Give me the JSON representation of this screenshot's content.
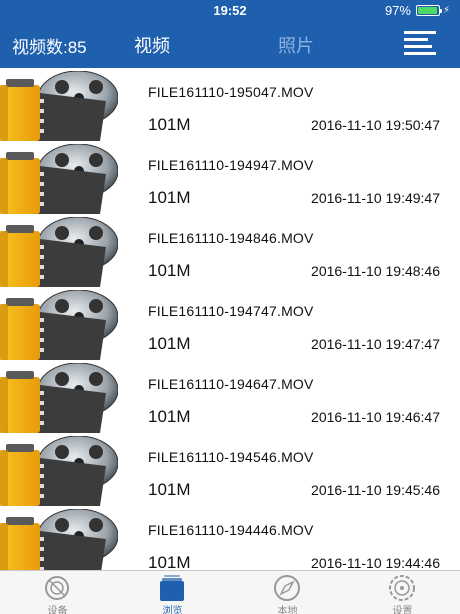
{
  "status_bar": {
    "time": "19:52",
    "battery_text": "97%",
    "battery_level": 0.97
  },
  "nav": {
    "video_count": "视频数:85",
    "tab_video": "视频",
    "tab_photo": "照片",
    "menu_icon": "list-menu-icon"
  },
  "files": [
    {
      "name": "FILE161110-195047.MOV",
      "size": "101M",
      "date": "2016-11-10 19:50:47"
    },
    {
      "name": "FILE161110-194947.MOV",
      "size": "101M",
      "date": "2016-11-10 19:49:47"
    },
    {
      "name": "FILE161110-194846.MOV",
      "size": "101M",
      "date": "2016-11-10 19:48:46"
    },
    {
      "name": "FILE161110-194747.MOV",
      "size": "101M",
      "date": "2016-11-10 19:47:47"
    },
    {
      "name": "FILE161110-194647.MOV",
      "size": "101M",
      "date": "2016-11-10 19:46:47"
    },
    {
      "name": "FILE161110-194546.MOV",
      "size": "101M",
      "date": "2016-11-10 19:45:46"
    },
    {
      "name": "FILE161110-194446.MOV",
      "size": "101M",
      "date": "2016-11-10 19:44:46"
    }
  ],
  "thumbnail_icon": "film-reel-icon",
  "tabs": [
    {
      "label": "设备",
      "icon": "device-icon"
    },
    {
      "label": "浏览",
      "icon": "browse-icon"
    },
    {
      "label": "本地",
      "icon": "compass-icon"
    },
    {
      "label": "设置",
      "icon": "settings-icon"
    }
  ],
  "colors": {
    "brand": "#1e5fae",
    "tab_inactive": "#888888",
    "photo_tab_inactive": "#8fb2de"
  }
}
